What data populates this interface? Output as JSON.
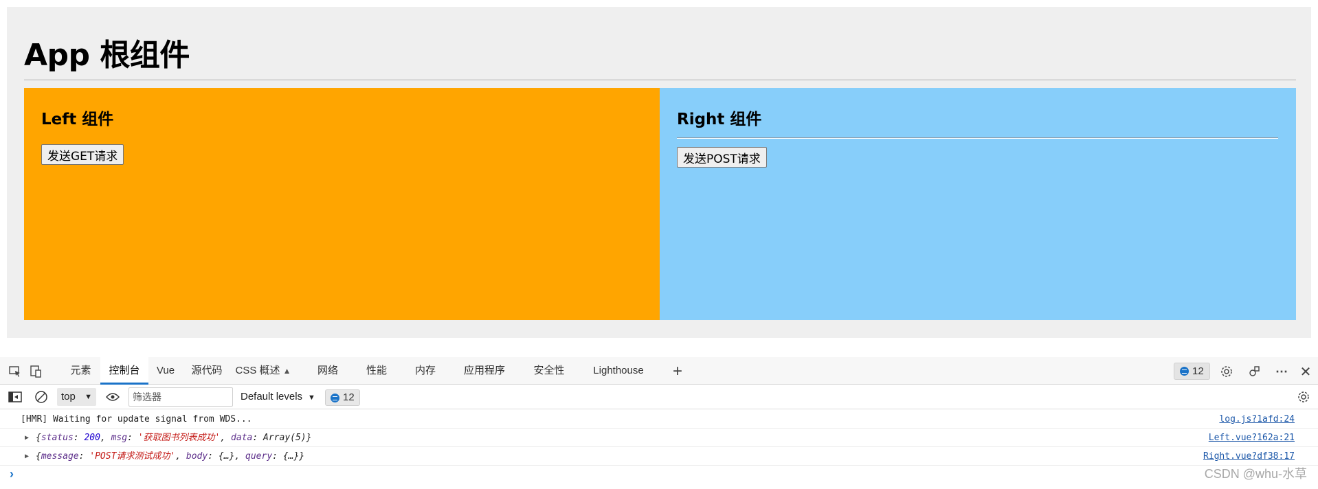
{
  "app": {
    "title": "App 根组件",
    "left": {
      "title": "Left 组件",
      "button_label": "发送GET请求",
      "bg": "#ffa500"
    },
    "right": {
      "title": "Right 组件",
      "button_label": "发送POST请求",
      "bg": "#87cefa"
    }
  },
  "devtools": {
    "tabs": [
      {
        "label": "元素",
        "active": false
      },
      {
        "label": "控制台",
        "active": true
      },
      {
        "label": "Vue",
        "active": false
      },
      {
        "label": "源代码",
        "active": false
      },
      {
        "label": "CSS 概述",
        "active": false
      },
      {
        "label": "网络",
        "active": false
      },
      {
        "label": "性能",
        "active": false
      },
      {
        "label": "内存",
        "active": false
      },
      {
        "label": "应用程序",
        "active": false
      },
      {
        "label": "安全性",
        "active": false
      },
      {
        "label": "Lighthouse",
        "active": false
      }
    ],
    "issues_count": "12",
    "filter": {
      "context": "top",
      "placeholder": "筛选器",
      "levels": "Default levels",
      "issues_count": "12"
    },
    "logs": [
      {
        "text": "[HMR] Waiting for update signal from WDS...",
        "source": "log.js?1afd:24"
      },
      {
        "parts": [
          "{",
          "status",
          ": ",
          "200",
          ", ",
          "msg",
          ": ",
          "'获取图书列表成功'",
          ", ",
          "data",
          ": Array(5)}"
        ],
        "source": "Left.vue?162a:21"
      },
      {
        "parts": [
          "{",
          "message",
          ": ",
          "'POST请求测试成功'",
          ", ",
          "body",
          ": {…}, ",
          "query",
          ": {…}}"
        ],
        "source": "Right.vue?df38:17"
      }
    ],
    "prompt": "›"
  },
  "watermark": "CSDN @whu-水草"
}
